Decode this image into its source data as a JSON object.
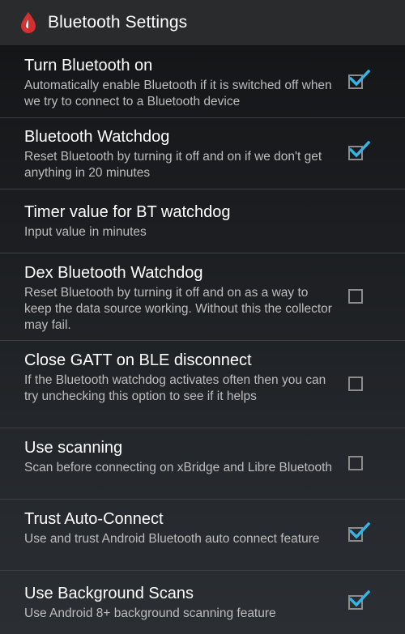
{
  "header": {
    "title": "Bluetooth Settings",
    "icon": "blood-drop-icon",
    "icon_color": "#d32f2f"
  },
  "colors": {
    "check": "#33b5e5",
    "title_text": "#ffffff",
    "summary_text": "#bdbdbd"
  },
  "prefs": [
    {
      "title": "Turn Bluetooth on",
      "summary": "Automatically enable Bluetooth if it is switched off when we try to connect to a Bluetooth device",
      "has_checkbox": true,
      "checked": true
    },
    {
      "title": "Bluetooth Watchdog",
      "summary": "Reset Bluetooth by turning it off and on if we don't get anything in 20 minutes",
      "has_checkbox": true,
      "checked": true
    },
    {
      "title": "Timer value for BT watchdog",
      "summary": "Input value in minutes",
      "has_checkbox": false,
      "checked": false
    },
    {
      "title": "Dex Bluetooth Watchdog",
      "summary": "Reset Bluetooth by turning it off and on as a way to keep the data source working. Without this the collector may fail.",
      "has_checkbox": true,
      "checked": false
    },
    {
      "title": "Close GATT on BLE disconnect",
      "summary": "If the Bluetooth watchdog activates often then you can try unchecking this option to see if it helps",
      "has_checkbox": true,
      "checked": false
    },
    {
      "title": "Use scanning",
      "summary": "Scan before connecting on xBridge and Libre Bluetooth",
      "has_checkbox": true,
      "checked": false
    },
    {
      "title": "Trust Auto-Connect",
      "summary": "Use and trust Android Bluetooth auto connect feature",
      "has_checkbox": true,
      "checked": true
    },
    {
      "title": "Use Background Scans",
      "summary": "Use Android 8+ background scanning feature",
      "has_checkbox": true,
      "checked": true
    }
  ]
}
